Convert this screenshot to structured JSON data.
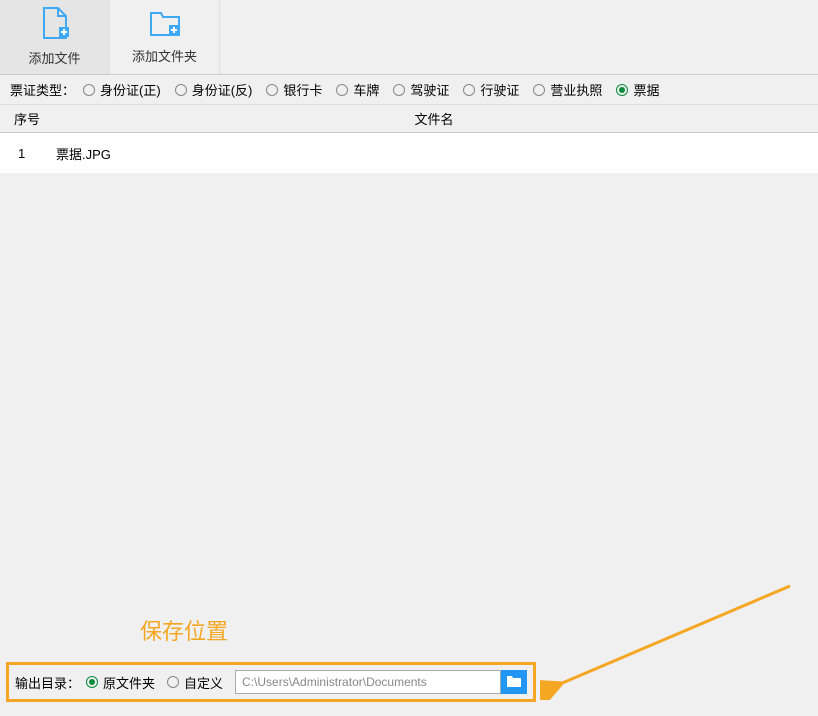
{
  "toolbar": {
    "addFile": "添加文件",
    "addFolder": "添加文件夹"
  },
  "typeRow": {
    "label": "票证类型：",
    "options": [
      {
        "label": "身份证(正)",
        "checked": false
      },
      {
        "label": "身份证(反)",
        "checked": false
      },
      {
        "label": "银行卡",
        "checked": false
      },
      {
        "label": "车牌",
        "checked": false
      },
      {
        "label": "驾驶证",
        "checked": false
      },
      {
        "label": "行驶证",
        "checked": false
      },
      {
        "label": "营业执照",
        "checked": false
      },
      {
        "label": "票据",
        "checked": true
      }
    ]
  },
  "table": {
    "headers": {
      "num": "序号",
      "name": "文件名"
    },
    "rows": [
      {
        "num": "1",
        "name": "票据.JPG"
      }
    ]
  },
  "annotation": "保存位置",
  "output": {
    "label": "输出目录：",
    "options": [
      {
        "label": "原文件夹",
        "checked": true
      },
      {
        "label": "自定义",
        "checked": false
      }
    ],
    "path": "C:\\Users\\Administrator\\Documents"
  }
}
